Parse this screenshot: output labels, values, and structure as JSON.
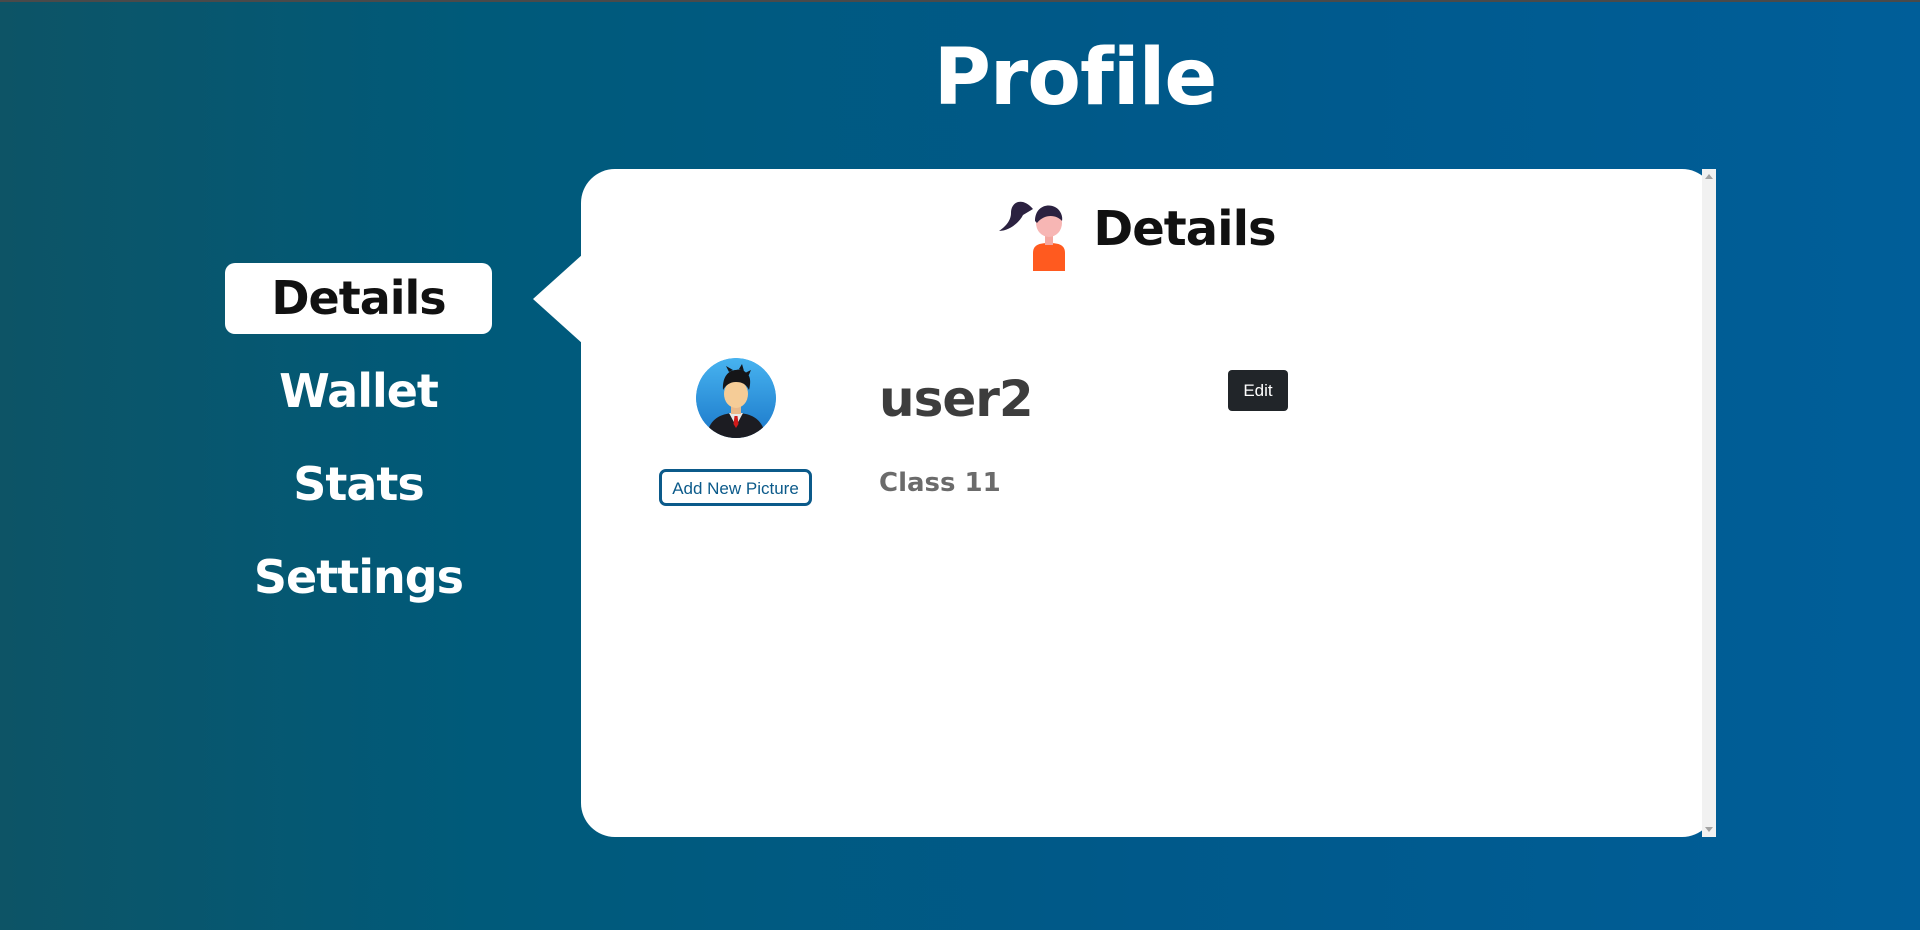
{
  "page": {
    "title": "Profile"
  },
  "sidebar": {
    "items": [
      {
        "label": "Details",
        "active": true
      },
      {
        "label": "Wallet",
        "active": false
      },
      {
        "label": "Stats",
        "active": false
      },
      {
        "label": "Settings",
        "active": false
      }
    ]
  },
  "details_card": {
    "header_icon": "user-ponytail-icon",
    "title": "Details",
    "avatar_icon": "user-avatar-icon",
    "add_picture_label": "Add New Picture",
    "username": "user2",
    "class_label": "Class 11",
    "edit_label": "Edit"
  },
  "colors": {
    "bg_left": "#0d5466",
    "bg_right": "#005e99",
    "accent": "#0b5a8a",
    "edit_button": "#212529",
    "card": "#ffffff"
  }
}
